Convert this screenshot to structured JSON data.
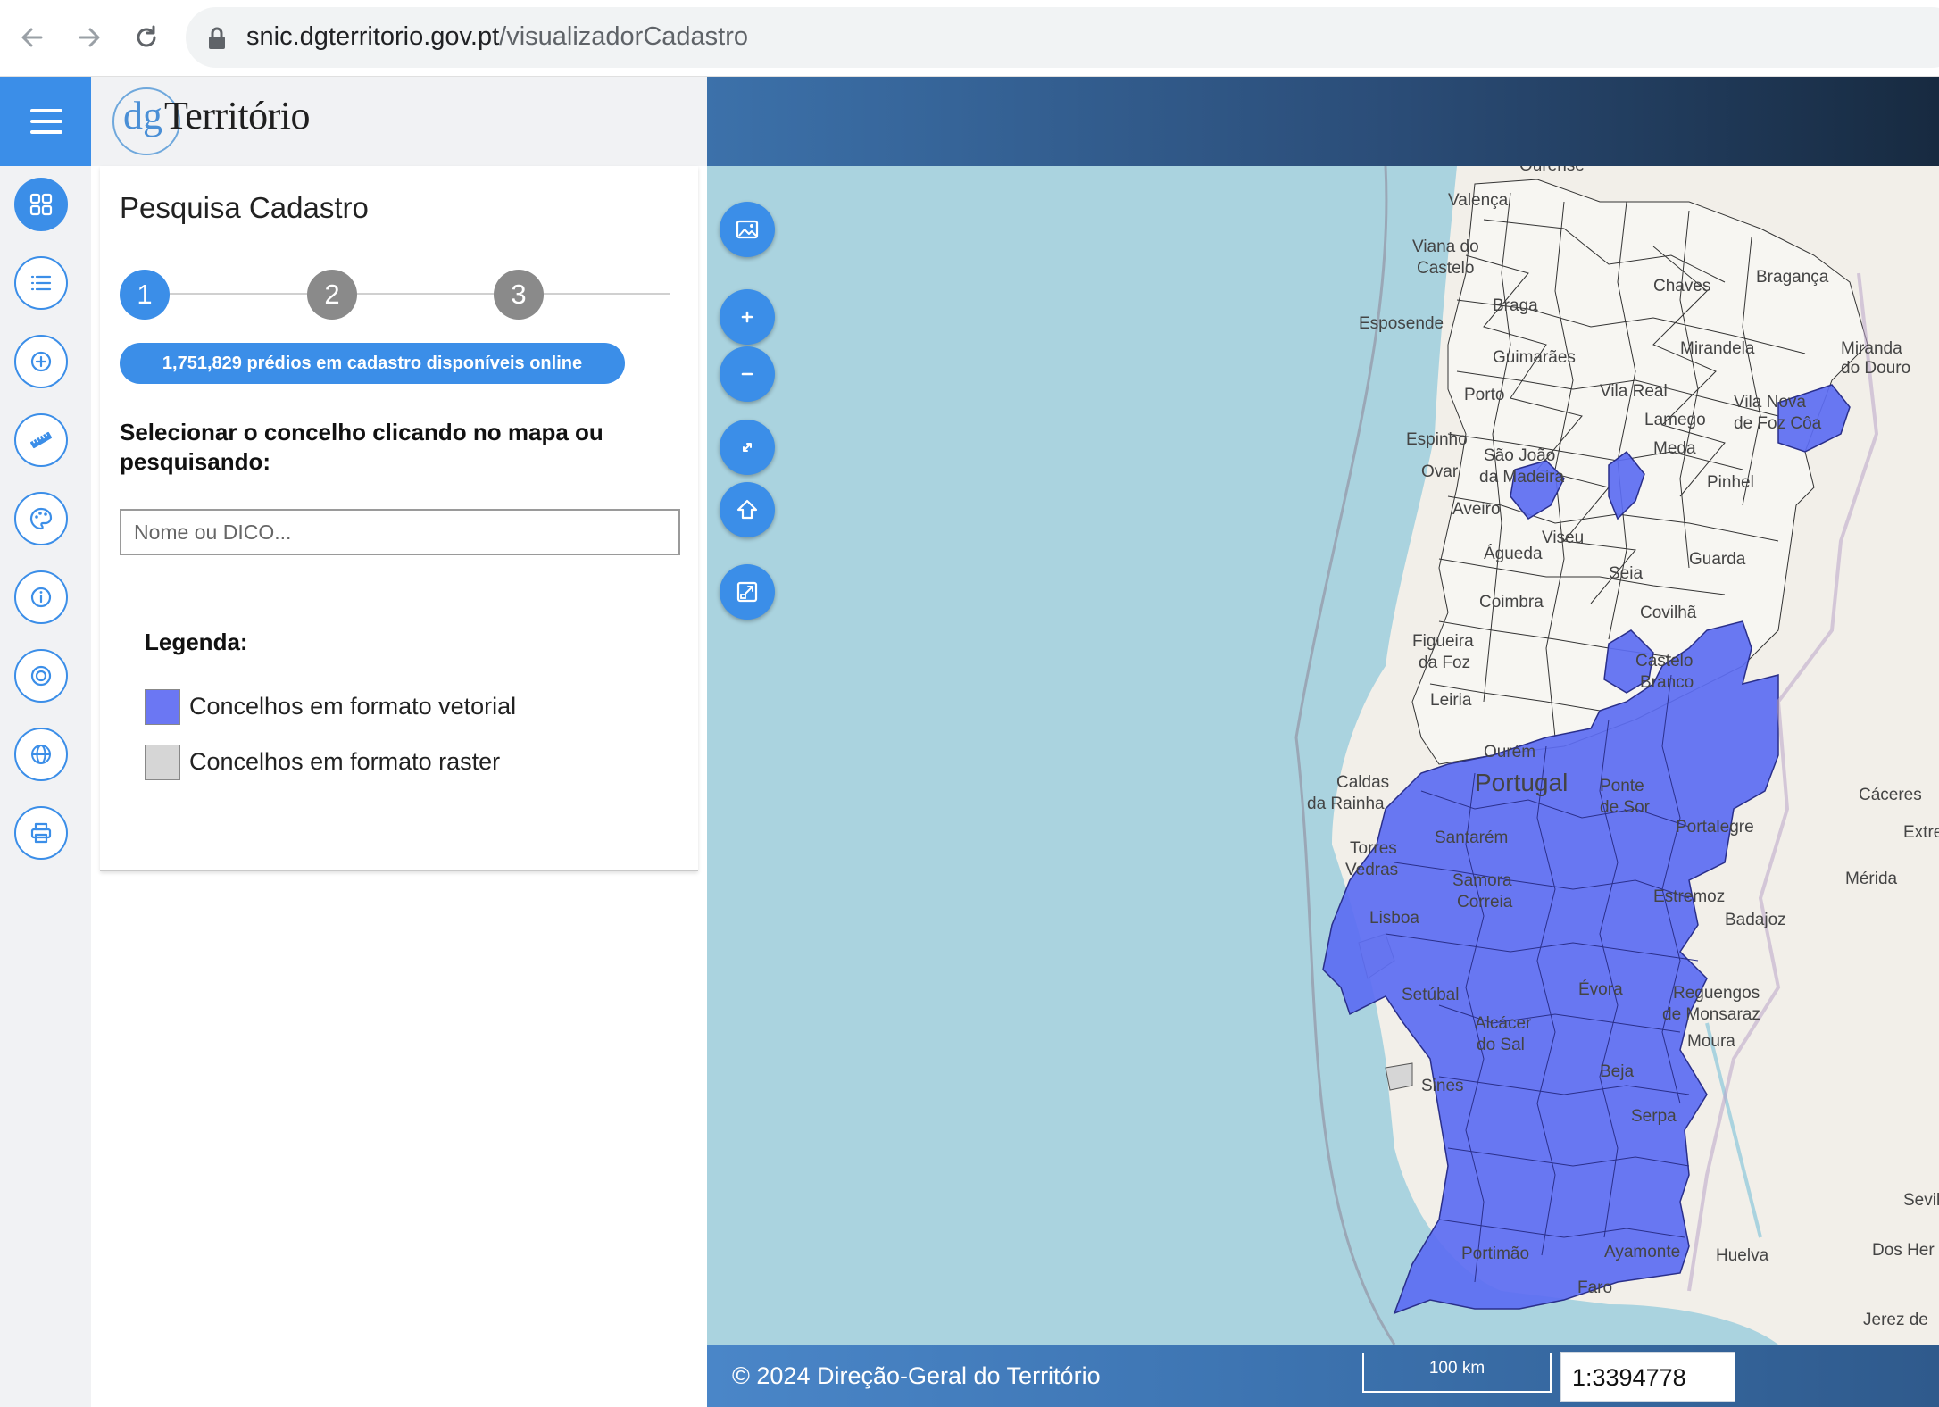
{
  "browser": {
    "url_host": "snic.dgterritorio.gov.pt",
    "url_path": "/visualizadorCadastro"
  },
  "header": {
    "logo_prefix": "dg",
    "logo_text": "Território"
  },
  "sidebar": {
    "items": [
      {
        "icon": "grid-icon",
        "active": true
      },
      {
        "icon": "list-icon",
        "active": false
      },
      {
        "icon": "add-layer-icon",
        "active": false
      },
      {
        "icon": "ruler-icon",
        "active": false
      },
      {
        "icon": "palette-icon",
        "active": false
      },
      {
        "icon": "info-icon",
        "active": false
      },
      {
        "icon": "target-icon",
        "active": false
      },
      {
        "icon": "globe-icon",
        "active": false
      },
      {
        "icon": "print-icon",
        "active": false
      }
    ]
  },
  "panel": {
    "title": "Pesquisa Cadastro",
    "steps": [
      "1",
      "2",
      "3"
    ],
    "active_step": 1,
    "count_text": "1,751,829 prédios em cadastro disponíveis online",
    "instruction": "Selecionar o concelho clicando no mapa ou pesquisando:",
    "search_placeholder": "Nome ou DICO...",
    "legend_title": "Legenda:",
    "legend_items": [
      {
        "label": "Concelhos em formato vetorial",
        "color": "#6b77f3"
      },
      {
        "label": "Concelhos em formato raster",
        "color": "#d6d6d6"
      }
    ]
  },
  "map": {
    "tools": [
      "image-icon",
      "zoom-in-icon",
      "zoom-out-icon",
      "fullscreen-icon",
      "home-icon",
      "export-icon"
    ],
    "labels": {
      "valenca": "Valença",
      "viana1": "Viana do",
      "viana2": "Castelo",
      "braga": "Braga",
      "chaves": "Chaves",
      "braganca": "Bragança",
      "esposende": "Esposende",
      "guimaraes": "Guimarães",
      "mirandela": "Mirandela",
      "miranda1": "Miranda",
      "miranda2": "do Douro",
      "porto": "Porto",
      "vilareal": "Vila Real",
      "lamego": "Lamego",
      "vilanova1": "Vila Nova",
      "vilanova2": "de Foz Côa",
      "espinho": "Espinho",
      "ovar": "Ovar",
      "saojoao1": "São João",
      "saojoao2": "da Madeira",
      "meda": "Meda",
      "pinhel": "Pinhel",
      "aveiro": "Aveiro",
      "viseu": "Viseu",
      "agueda": "Águeda",
      "guarda": "Guarda",
      "seia": "Seia",
      "coimbra": "Coimbra",
      "covilha": "Covilhã",
      "figueira1": "Figueira",
      "figueira2": "da Foz",
      "castelo1": "Castelo",
      "castelo2": "Branco",
      "leiria": "Leiria",
      "ourem": "Ourém",
      "portugal": "Portugal",
      "caldas1": "Caldas",
      "caldas2": "da Rainha",
      "ponte1": "Ponte",
      "ponte2": "de Sor",
      "caceres": "Cáceres",
      "extrema": "Extrema",
      "santarem": "Santarém",
      "portalegre": "Portalegre",
      "torres1": "Torres",
      "torres2": "Vedras",
      "samora1": "Samora",
      "samora2": "Correia",
      "merida": "Mérida",
      "estremoz": "Estremoz",
      "lisboa": "Lisboa",
      "badajoz": "Badajoz",
      "evora": "Évora",
      "reguengos1": "Reguengos",
      "reguengos2": "de Monsaraz",
      "setubal": "Setúbal",
      "alcacer1": "Alcácer",
      "alcacer2": "do Sal",
      "moura": "Moura",
      "beja": "Beja",
      "sines": "Sines",
      "serpa": "Serpa",
      "sevilla": "Sevill",
      "portimao": "Portimão",
      "ayamonte": "Ayamonte",
      "huelva": "Huelva",
      "doshermanas": "Dos Her",
      "faro": "Faro",
      "jerez": "Jerez de",
      "ourense": "Ourense"
    },
    "colors": {
      "sea": "#aad3df",
      "land": "#f2efe9",
      "vector": "#5c6cf2",
      "raster": "#d6d6d6"
    }
  },
  "footer": {
    "copyright": "© 2024 Direção-Geral do Território",
    "scale_label": "100 km",
    "scale_value": "1:3394778"
  }
}
